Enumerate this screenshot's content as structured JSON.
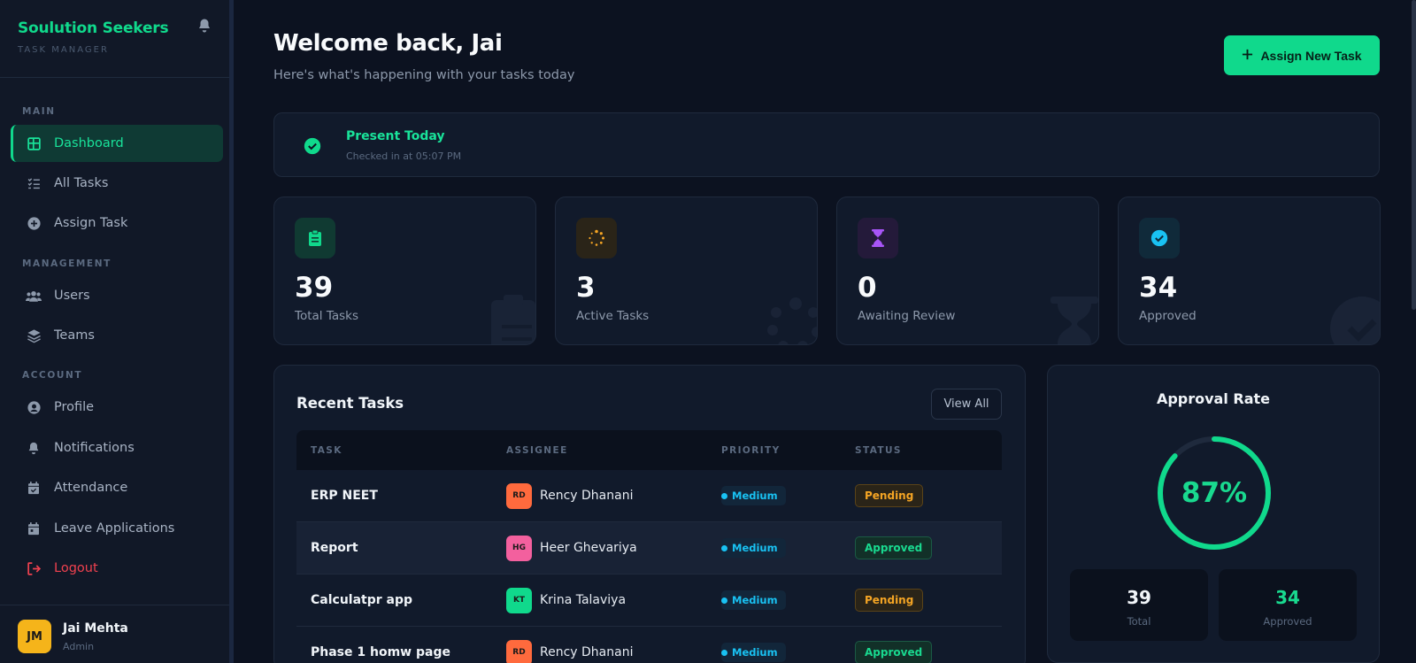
{
  "brand": {
    "name": "Soulution Seekers",
    "subtitle": "TASK MANAGER"
  },
  "sidebar": {
    "sections": {
      "main": "MAIN",
      "management": "MANAGEMENT",
      "account": "ACCOUNT"
    },
    "items": [
      {
        "label": "Dashboard",
        "icon": "dashboard-icon"
      },
      {
        "label": "All Tasks",
        "icon": "list-check-icon"
      },
      {
        "label": "Assign Task",
        "icon": "plus-circle-icon"
      },
      {
        "label": "Users",
        "icon": "users-icon"
      },
      {
        "label": "Teams",
        "icon": "layers-icon"
      },
      {
        "label": "Profile",
        "icon": "user-circle-icon"
      },
      {
        "label": "Notifications",
        "icon": "bell-icon"
      },
      {
        "label": "Attendance",
        "icon": "calendar-check-icon"
      },
      {
        "label": "Leave Applications",
        "icon": "calendar-icon"
      },
      {
        "label": "Logout",
        "icon": "logout-icon"
      }
    ],
    "user": {
      "initials": "JM",
      "name": "Jai Mehta",
      "role": "Admin"
    }
  },
  "header": {
    "welcome": "Welcome back, Jai",
    "subtitle": "Here's what's happening with your tasks today",
    "assign_button": "Assign New Task"
  },
  "attendance": {
    "title": "Present Today",
    "detail": "Checked in at 05:07 PM"
  },
  "stats": [
    {
      "value": "39",
      "label": "Total Tasks",
      "icon": "clipboard-icon",
      "color": "#10d98c"
    },
    {
      "value": "3",
      "label": "Active Tasks",
      "icon": "spinner-icon",
      "color": "#f5a524"
    },
    {
      "value": "0",
      "label": "Awaiting Review",
      "icon": "hourglass-icon",
      "color": "#a855f7"
    },
    {
      "value": "34",
      "label": "Approved",
      "icon": "check-circle-icon",
      "color": "#19c2f3"
    }
  ],
  "recent_tasks": {
    "title": "Recent Tasks",
    "view_all": "View All",
    "columns": [
      "TASK",
      "ASSIGNEE",
      "PRIORITY",
      "STATUS"
    ],
    "rows": [
      {
        "task": "ERP NEET",
        "initials": "RD",
        "assignee": "Rency Dhanani",
        "avatar_color": "#ff6a3d",
        "priority": "Medium",
        "status": "Pending"
      },
      {
        "task": "Report",
        "initials": "HG",
        "assignee": "Heer Ghevariya",
        "avatar_color": "#f3609e",
        "priority": "Medium",
        "status": "Approved"
      },
      {
        "task": "Calculatpr app",
        "initials": "KT",
        "assignee": "Krina Talaviya",
        "avatar_color": "#10d98c",
        "priority": "Medium",
        "status": "Pending"
      },
      {
        "task": "Phase 1 homw page",
        "initials": "RD",
        "assignee": "Rency Dhanani",
        "avatar_color": "#ff6a3d",
        "priority": "Medium",
        "status": "Approved"
      }
    ]
  },
  "approval": {
    "title": "Approval Rate",
    "rate_label": "87%",
    "rate": 0.87,
    "total_value": "39",
    "total_label": "Total",
    "approved_value": "34",
    "approved_label": "Approved"
  },
  "colors": {
    "accent": "#10d98c",
    "danger": "#f0414f",
    "warning": "#f5a524",
    "info": "#19c2f3"
  }
}
